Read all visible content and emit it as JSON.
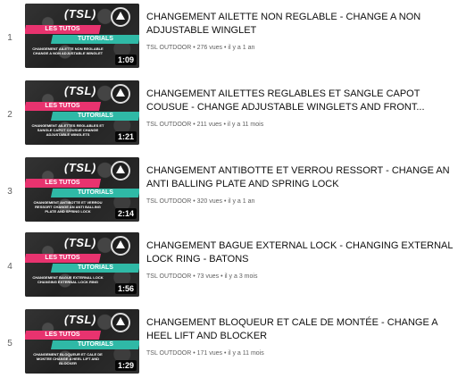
{
  "thumbnail": {
    "brand": "(TSL)",
    "band1": "LES TUTOS",
    "band2": "TUTORIALS"
  },
  "videos": [
    {
      "index": "1",
      "title": "CHANGEMENT AILETTE NON REGLABLE - CHANGE A NON ADJUSTABLE WINGLET",
      "caption": "CHANGEMENT AILETTE NON REGLABLE CHANGE A NON ADJUSTABLE WINGLET",
      "duration": "1:09",
      "meta": "TSL OUTDOOR • 276 vues • il y a 1 an"
    },
    {
      "index": "2",
      "title": "CHANGEMENT AILETTES REGLABLES ET SANGLE CAPOT COUSUE - CHANGE ADJUSTABLE WINGLETS AND FRONT...",
      "caption": "CHANGEMENT AILETTES REGLABLES ET SANGLE CAPOT COUSUE CHANGE ADJUSTABLE WINGLETS",
      "duration": "1:21",
      "meta": "TSL OUTDOOR • 211 vues • il y a 11 mois"
    },
    {
      "index": "3",
      "title": "CHANGEMENT ANTIBOTTE ET VERROU RESSORT - CHANGE AN ANTI BALLING PLATE AND SPRING LOCK",
      "caption": "CHANGEMENT ANTIBOTTE ET VERROU RESSORT CHANGE AN ANTI BALLING PLATE AND SPRING LOCK",
      "duration": "2:14",
      "meta": "TSL OUTDOOR • 320 vues • il y a 1 an"
    },
    {
      "index": "4",
      "title": "CHANGEMENT BAGUE EXTERNAL LOCK - CHANGING EXTERNAL LOCK RING - BATONS",
      "caption": "CHANGEMENT BAGUE EXTERNAL LOCK CHANGING EXTERNAL LOCK RING",
      "duration": "1:56",
      "meta": "TSL OUTDOOR • 73 vues • il y a 3 mois"
    },
    {
      "index": "5",
      "title": "CHANGEMENT BLOQUEUR ET CALE DE MONTÉE - CHANGE A HEEL LIFT AND BLOCKER",
      "caption": "CHANGEMENT BLOQUEUR ET CALE DE MONTEE CHANGE A HEEL LIFT AND BLOCKER",
      "duration": "1:29",
      "meta": "TSL OUTDOOR • 171 vues • il y a 11 mois"
    }
  ]
}
